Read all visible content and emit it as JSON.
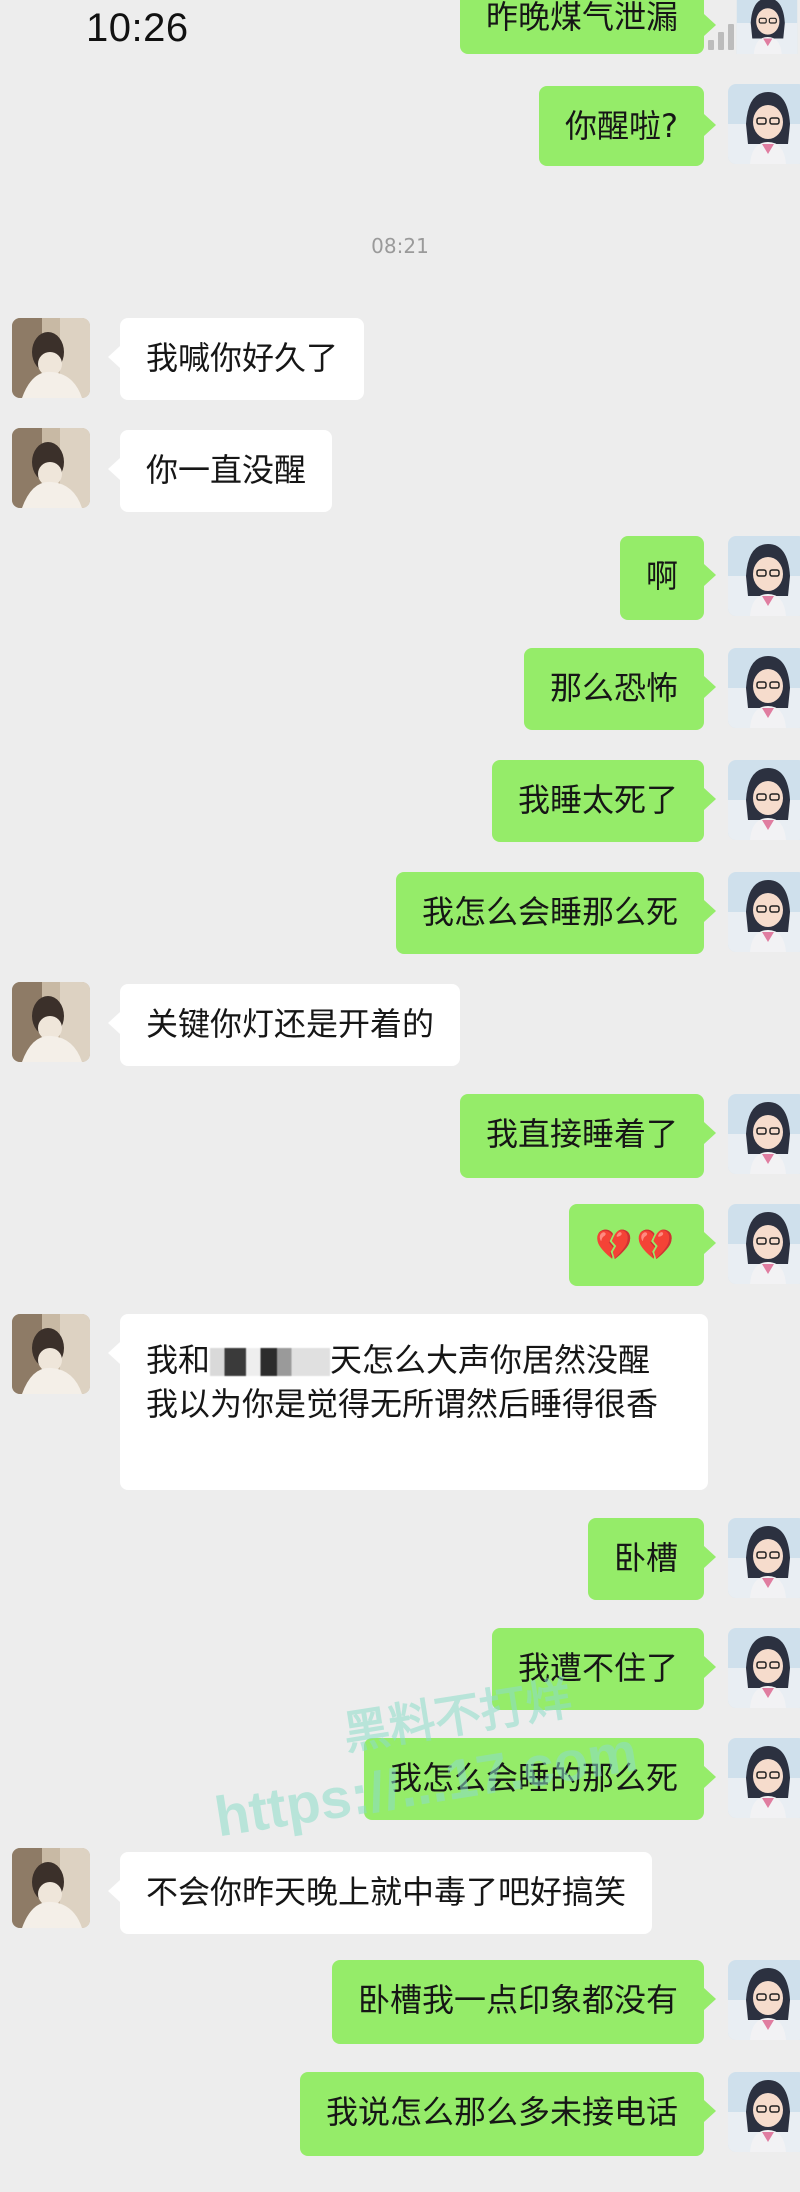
{
  "status_bar": {
    "time": "10:26"
  },
  "conversation": {
    "timestamp": "08:21",
    "messages": [
      {
        "side": "right",
        "text": "昨晚煤气泄漏"
      },
      {
        "side": "right",
        "text": "你醒啦?"
      },
      {
        "side": "left",
        "text": "我喊你好久了"
      },
      {
        "side": "left",
        "text": "你一直没醒"
      },
      {
        "side": "right",
        "text": "啊"
      },
      {
        "side": "right",
        "text": "那么恐怖"
      },
      {
        "side": "right",
        "text": "我睡太死了"
      },
      {
        "side": "right",
        "text": "我怎么会睡那么死"
      },
      {
        "side": "left",
        "text": "关键你灯还是开着的"
      },
      {
        "side": "right",
        "text": "我直接睡着了"
      },
      {
        "side": "right",
        "text": "💔💔"
      },
      {
        "side": "left",
        "text_before": "我和",
        "text_after": "天怎么大声你居然没醒 我以为你是觉得无所谓然后睡得很香"
      },
      {
        "side": "right",
        "text": "卧槽"
      },
      {
        "side": "right",
        "text": "我遭不住了"
      },
      {
        "side": "right",
        "text": "我怎么会睡的那么死"
      },
      {
        "side": "left",
        "text": "不会你昨天晚上就中毒了吧好搞笑"
      },
      {
        "side": "right",
        "text": "卧槽我一点印象都没有"
      },
      {
        "side": "right",
        "text": "我说怎么那么多未接电话"
      }
    ]
  },
  "watermark": {
    "line1": "黑料不打烊",
    "line2": "https://...17.com"
  },
  "colors": {
    "background": "#ededed",
    "sent_bubble": "#95ec69",
    "received_bubble": "#ffffff"
  },
  "icons": {
    "left_avatar": "contact-avatar-photo",
    "right_avatar": "anime-girl-avatar"
  }
}
